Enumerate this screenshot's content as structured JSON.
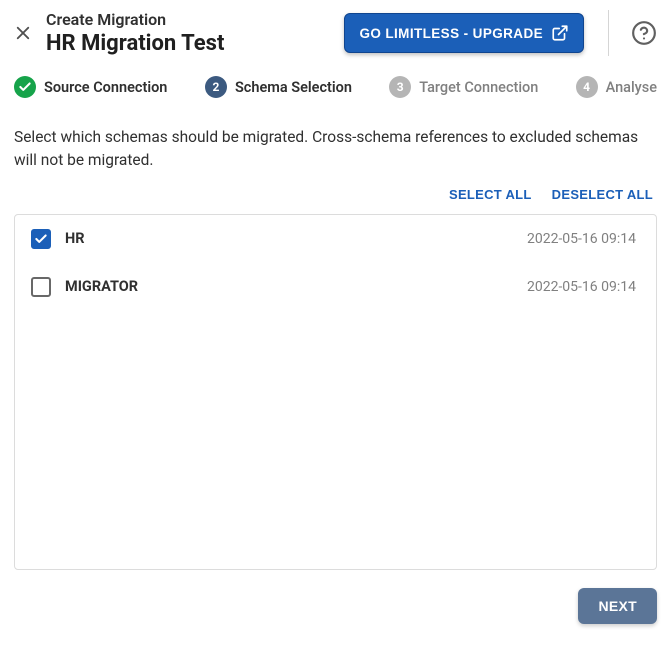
{
  "header": {
    "subtitle": "Create Migration",
    "title": "HR Migration Test",
    "upgrade_label": "GO LIMITLESS - UPGRADE"
  },
  "steps": [
    {
      "label": "Source Connection",
      "status": "done"
    },
    {
      "label": "Schema Selection",
      "status": "active",
      "num": "2"
    },
    {
      "label": "Target Connection",
      "status": "pending",
      "num": "3"
    },
    {
      "label": "Analyse",
      "status": "pending",
      "num": "4"
    }
  ],
  "description": "Select which schemas should be migrated. Cross-schema references to excluded schemas will not be migrated.",
  "actions": {
    "select_all": "SELECT ALL",
    "deselect_all": "DESELECT ALL"
  },
  "schemas": [
    {
      "name": "HR",
      "updated": "2022-05-16 09:14",
      "selected": true
    },
    {
      "name": "MIGRATOR",
      "updated": "2022-05-16 09:14",
      "selected": false
    }
  ],
  "footer": {
    "next": "NEXT"
  }
}
